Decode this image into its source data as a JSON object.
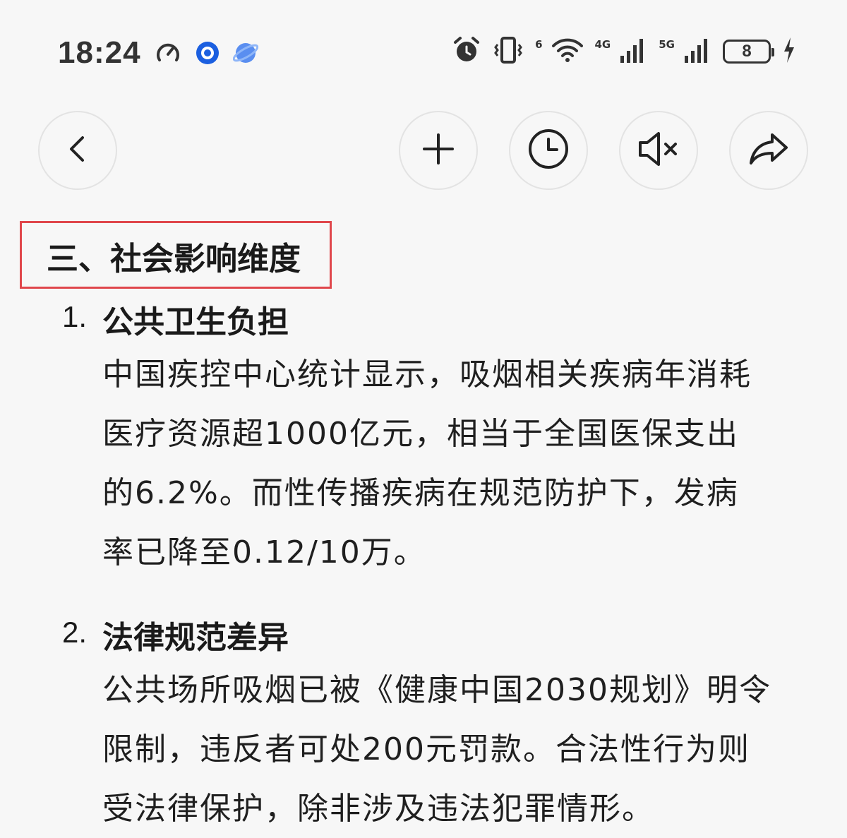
{
  "status_bar": {
    "time": "18:24",
    "battery": "8",
    "wifi_badge": "6",
    "net1": "4G",
    "net2": "5G"
  },
  "toolbar": {
    "back_icon": "chevron-left-icon",
    "add_icon": "plus-icon",
    "history_icon": "clock-icon",
    "mute_icon": "speaker-mute-icon",
    "share_icon": "share-arrow-icon"
  },
  "content": {
    "section_title": "三、社会影响维度",
    "items": [
      {
        "num": "1.",
        "title": "公共卫生负担",
        "lines": [
          "中国疾控中心统计显示，吸烟相关疾病年消耗",
          "医疗资源超1000亿元，相当于全国医保支出",
          "的6.2%。而性传播疾病在规范防护下，发病",
          "率已降至0.12/10万。"
        ]
      },
      {
        "num": "2.",
        "title": "法律规范差异",
        "lines": [
          "公共场所吸烟已被《健康中国2030规划》明令",
          "限制，违反者可处200元罚款。合法性行为则",
          "受法律保护，除非涉及违法犯罪情形。"
        ]
      }
    ]
  },
  "colors": {
    "highlight_border": "#e0474c",
    "background": "#f7f7f7",
    "text": "#1f1f1f"
  }
}
